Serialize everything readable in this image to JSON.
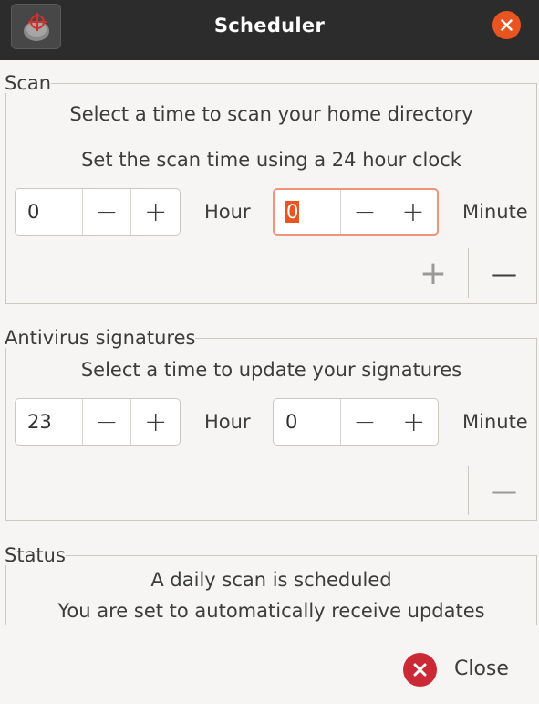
{
  "window": {
    "title": "Scheduler",
    "app_icon": "clamtk-logo-icon",
    "close_icon": "window-close-icon",
    "accent_color": "#e95420"
  },
  "scan": {
    "legend": "Scan",
    "line1": "Select a time to scan your home directory",
    "line2": "Set the scan time using a 24 hour clock",
    "hour_value": "0",
    "hour_unit": "Hour",
    "minute_value": "0",
    "minute_unit": "Minute",
    "decrement_symbol": "−",
    "increment_symbol": "+",
    "add_symbol": "+",
    "remove_symbol": "—"
  },
  "signatures": {
    "legend": "Antivirus signatures",
    "line1": "Select a time to update your signatures",
    "hour_value": "23",
    "hour_unit": "Hour",
    "minute_value": "0",
    "minute_unit": "Minute",
    "decrement_symbol": "−",
    "increment_symbol": "+",
    "remove_symbol": "—"
  },
  "status": {
    "legend": "Status",
    "line1": "A daily scan is scheduled",
    "line2": "You are set to automatically receive updates"
  },
  "footer": {
    "close_label": "Close",
    "close_icon": "close-circle-icon",
    "close_color": "#cc2936"
  }
}
